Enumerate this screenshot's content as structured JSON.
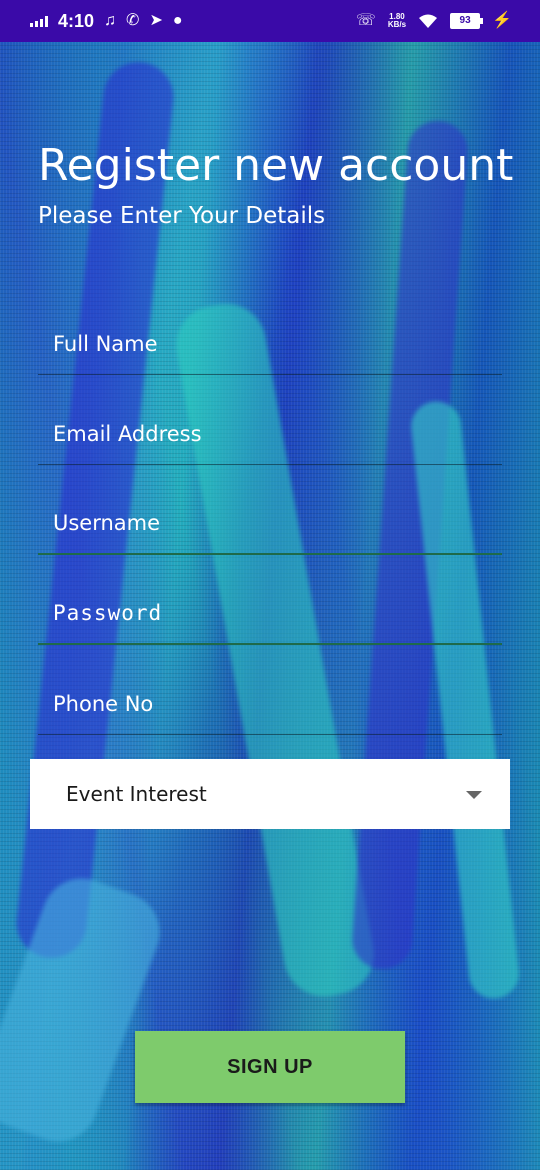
{
  "status_bar": {
    "time": "4:10",
    "notification_icons": [
      "music-note-icon",
      "whatsapp-icon",
      "telegram-icon",
      "message-icon"
    ],
    "speed_value": "1.80",
    "speed_unit": "KB/s",
    "battery": "93"
  },
  "header": {
    "title": "Register new account",
    "subtitle": "Please Enter Your Details"
  },
  "form": {
    "full_name_placeholder": "Full Name",
    "email_placeholder": "Email Address",
    "username_placeholder": "Username",
    "password_placeholder": "Password",
    "phone_placeholder": "Phone No",
    "event_interest": "Event Interest"
  },
  "actions": {
    "signup_label": "SIGN UP"
  },
  "colors": {
    "status_bar": "#3a0aa8",
    "signup_button": "#7ecb6c",
    "text": "#ffffff"
  }
}
